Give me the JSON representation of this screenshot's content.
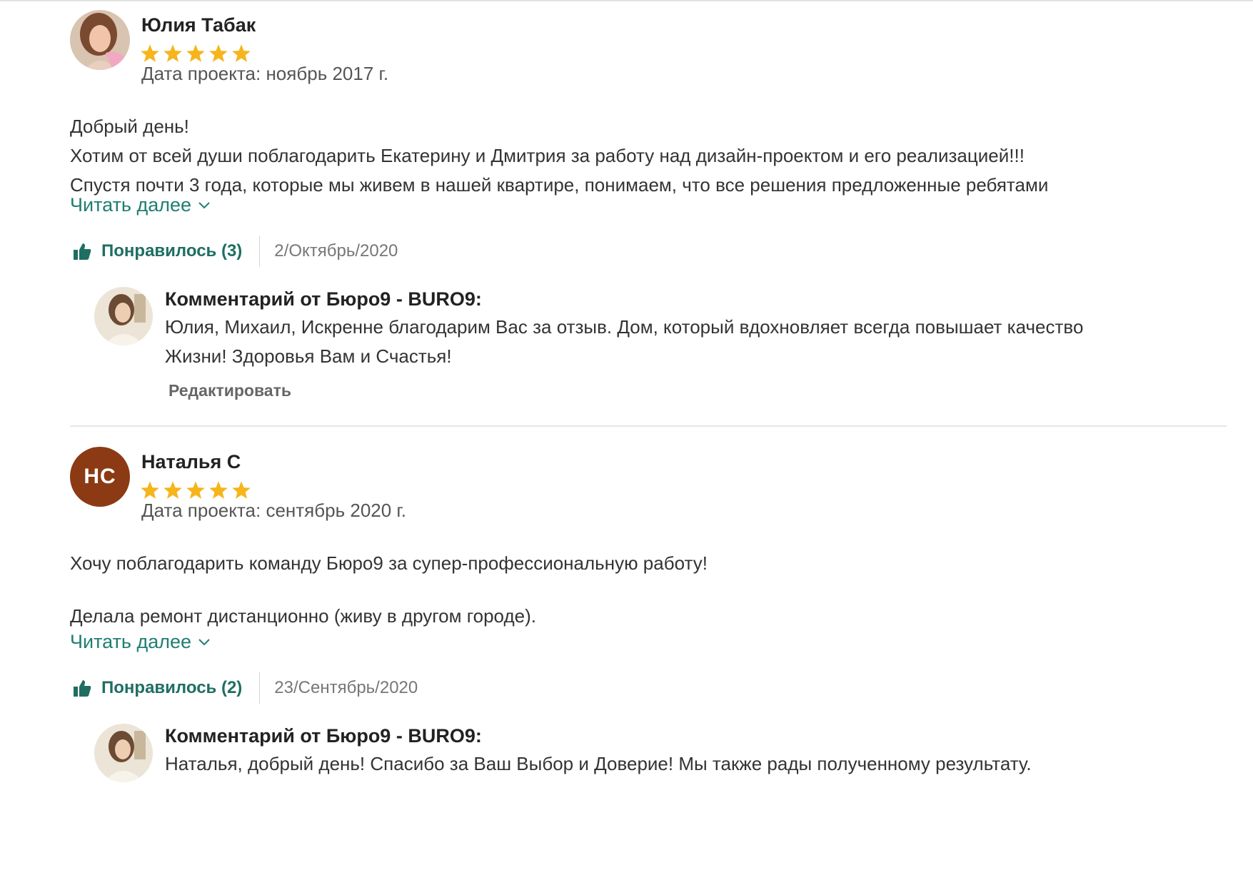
{
  "reviews": [
    {
      "author": "Юлия Табак",
      "avatar_initials": "",
      "rating": 5,
      "project_date": "Дата проекта: ноябрь 2017 г.",
      "body": [
        "Добрый день!",
        "Хотим от всей души поблагодарить Екатерину и Дмитрия за работу над дизайн-проектом и его реализацией!!!",
        "Спустя почти 3 года, которые мы живем в нашей квартире, понимаем, что все решения предложенные ребятами"
      ],
      "read_more": "Читать далее",
      "like_label": "Понравилось (3)",
      "date": "2/Октябрь/2020",
      "reply": {
        "title": "Комментарий от Бюро9 - BURO9:",
        "text": [
          "Юлия, Михаил, Искренне благодарим Вас за отзыв. Дом, который вдохновляет всегда повышает качество",
          "Жизни! Здоровья Вам и Счастья!"
        ],
        "edit_label": "Редактировать"
      }
    },
    {
      "author": "Наталья С",
      "avatar_initials": "НС",
      "rating": 5,
      "project_date": "Дата проекта: сентябрь 2020 г.",
      "body": [
        "Хочу поблагодарить команду Бюро9 за супер-профессиональную работу!",
        "",
        "Делала ремонт дистанционно (живу в другом городе)."
      ],
      "read_more": "Читать далее",
      "like_label": "Понравилось (2)",
      "date": "23/Сентябрь/2020",
      "reply": {
        "title": "Комментарий от Бюро9 - BURO9:",
        "text": [
          "Наталья, добрый день! Спасибо за Ваш Выбор и Доверие! Мы также рады полученному результату."
        ]
      }
    }
  ],
  "colors": {
    "star": "#f5b51b",
    "link": "#1f7e71",
    "like": "#1f6e62",
    "initials_bg": "#8c3a13"
  }
}
